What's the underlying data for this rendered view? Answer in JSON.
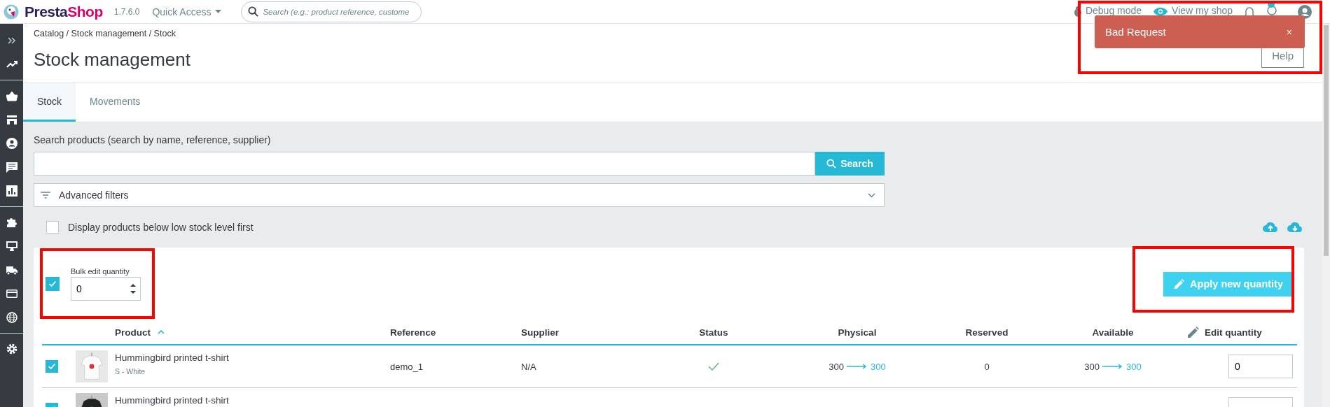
{
  "topbar": {
    "logo": {
      "part_1": "Presta",
      "part_2": "Shop"
    },
    "version": "1.7.6.0",
    "quick_access": "Quick Access",
    "search": {
      "placeholder": "Search (e.g.: product reference, custome"
    },
    "debug_mode": "Debug mode",
    "view_shop": "View my shop"
  },
  "notification": {
    "text": "Bad Request",
    "close": "×"
  },
  "breadcrumb": "Catalog / Stock management / Stock",
  "title": "Stock management",
  "help_button": "Help",
  "tabs": [
    {
      "label": "Stock",
      "selected": true
    },
    {
      "label": "Movements",
      "selected": false
    }
  ],
  "search": {
    "label": "Search products (search by name, reference, supplier)",
    "button": "Search"
  },
  "advanced_filters": "Advanced filters",
  "low_stock": {
    "label": "Display products below low stock level first",
    "checked": false
  },
  "bulk": {
    "label": "Bulk edit quantity",
    "value": "0",
    "checked": true
  },
  "apply_button": "Apply new quantity",
  "columns": [
    {
      "label": "Product",
      "kind": "sortable"
    },
    {
      "label": "Reference",
      "kind": "plain"
    },
    {
      "label": "Supplier",
      "kind": "plain"
    },
    {
      "label": "Status",
      "kind": "plain"
    },
    {
      "label": "Physical",
      "kind": "plain"
    },
    {
      "label": "Reserved",
      "kind": "plain"
    },
    {
      "label": "Available",
      "kind": "plain"
    },
    {
      "label": "Edit quantity",
      "kind": "edit"
    }
  ],
  "rows": [
    {
      "checked": true,
      "dark": false,
      "product": "Hummingbird printed t-shirt",
      "combination": "S - White",
      "reference": "demo_1",
      "supplier": "N/A",
      "status_ok": true,
      "physical": [
        "300",
        "300"
      ],
      "reserved": "0",
      "available": [
        "300",
        "300"
      ],
      "edit_value": "0"
    },
    {
      "checked": true,
      "dark": true,
      "product": "Hummingbird printed t-shirt"
    }
  ]
}
